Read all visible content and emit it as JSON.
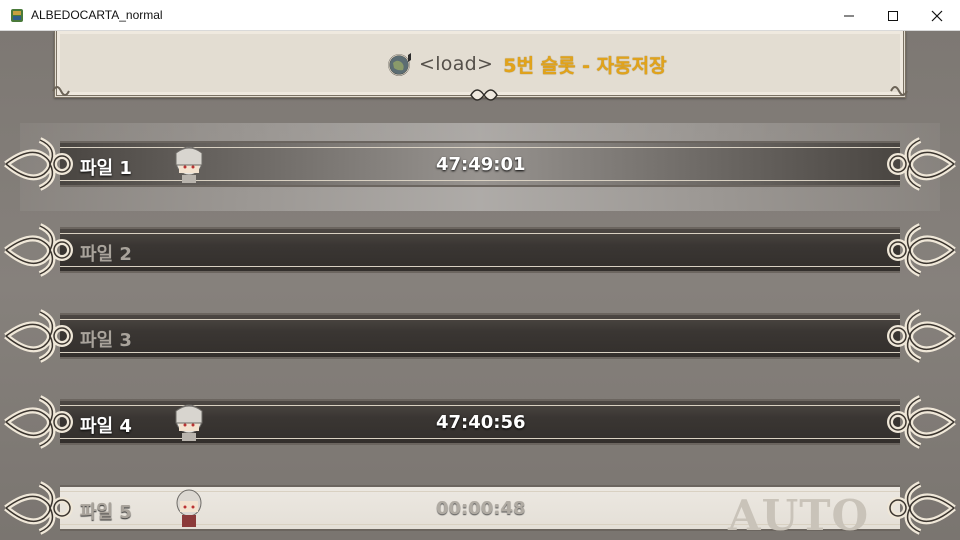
{
  "window": {
    "title": "ALBEDOCARTA_normal"
  },
  "header": {
    "mode_label": "<load>",
    "slot_title": "5번 슬롯 - 자동저장"
  },
  "slots": [
    {
      "label": "파일 1",
      "time": "47:49:01"
    },
    {
      "label": "파일 2",
      "time": ""
    },
    {
      "label": "파일 3",
      "time": ""
    },
    {
      "label": "파일 4",
      "time": "47:40:56"
    },
    {
      "label": "파일 5",
      "time": "00:00:48",
      "badge": "AUTO"
    }
  ],
  "colors": {
    "accent": "#e2a31a",
    "panel": "#e3ddd2",
    "bar": "#3a3633"
  },
  "icons": [
    "compass-globe-icon",
    "minimize-icon",
    "maximize-icon",
    "close-icon",
    "character-avatar"
  ]
}
